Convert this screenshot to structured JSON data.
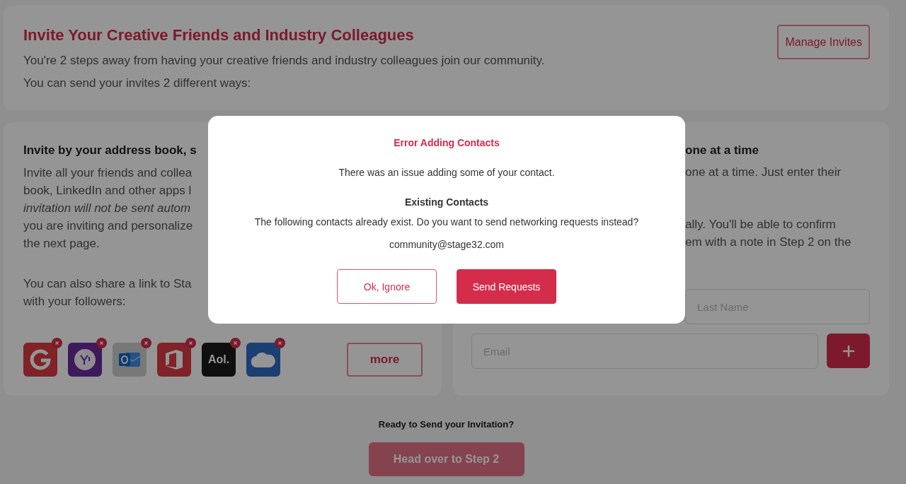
{
  "header": {
    "title": "Invite Your Creative Friends and Industry Colleagues",
    "lines": [
      "You're 2 steps away from having your creative friends and industry colleagues join our community.",
      "You can send your invites 2 different ways:"
    ],
    "manage_button": "Manage Invites"
  },
  "address_book": {
    "heading": "Invite by your address book, s",
    "lines": [
      {
        "text": "Invite all your friends and collea",
        "italic": false
      },
      {
        "text": "book, LinkedIn and other apps l",
        "italic": false
      },
      {
        "text": "invitation will not be sent autom",
        "italic": true
      },
      {
        "text": "you are inviting and personalize",
        "italic": false
      },
      {
        "text": "the next page.",
        "italic": false
      }
    ],
    "share_lines": [
      "You can also share a link to Sta",
      "with your followers:"
    ],
    "services": [
      {
        "kind": "g"
      },
      {
        "kind": "y"
      },
      {
        "kind": "envelope"
      },
      {
        "kind": "door"
      },
      {
        "kind": "wordmark",
        "label": "Aol."
      },
      {
        "kind": "cloud"
      }
    ],
    "more_button": "more"
  },
  "manual": {
    "heading": "one at a time",
    "paragraphs": [
      [
        "one at a time. Just enter their"
      ],
      [
        "ally. You'll be able to confirm",
        "em with a note in Step 2 on the"
      ]
    ],
    "last_name": {
      "placeholder": "Last Name"
    },
    "email": {
      "placeholder": "Email"
    }
  },
  "footer": {
    "prompt": "Ready to Send your Invitation?",
    "button": "Head over to Step 2",
    "disabled": true
  },
  "dialog": {
    "title": "Error Adding Contacts",
    "message": "There was an issue adding some of your contact.",
    "section_title": "Existing Contacts",
    "question": "The following contacts already exist. Do you want to send networking requests instead?",
    "contacts": [
      "community@stage32.com"
    ],
    "buttons": [
      {
        "label": "Ok, Ignore",
        "kind": "secondary"
      },
      {
        "label": "Send Requests",
        "kind": "primary"
      }
    ]
  }
}
